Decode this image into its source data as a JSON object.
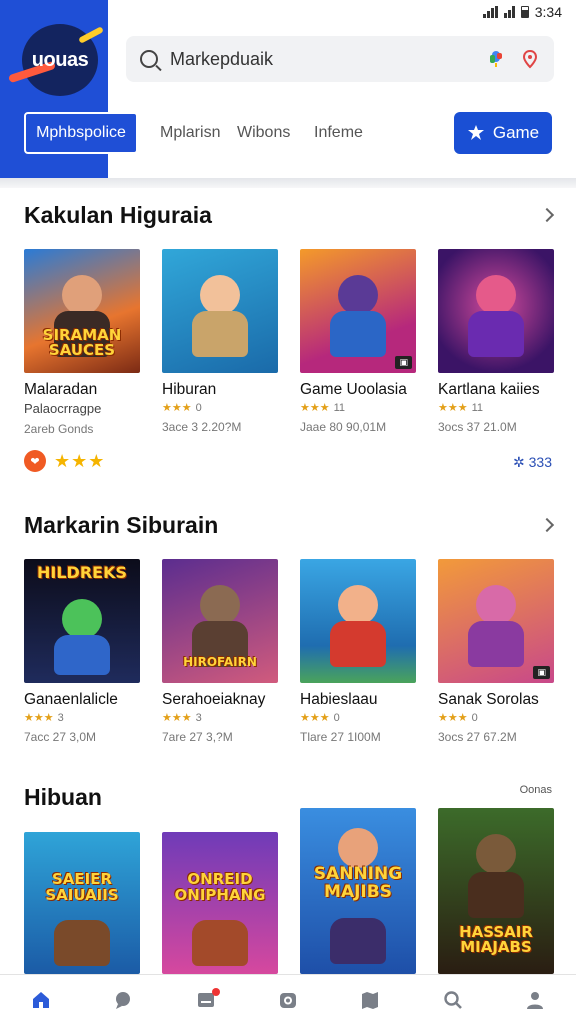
{
  "status_bar": {
    "time": "3:34"
  },
  "brand": {
    "logo_text": "uouas"
  },
  "search": {
    "value": "Markepduaik"
  },
  "tabs": [
    {
      "label": "Mphbspolice"
    },
    {
      "label": "Mplarisn"
    },
    {
      "label": "Wibons"
    },
    {
      "label": "Infeme"
    }
  ],
  "game_button": {
    "label": "Game"
  },
  "sections": [
    {
      "title": "Kakulan Higuraia",
      "cards": [
        {
          "title": "Malaradan",
          "subtitle": "Palaocrragpe",
          "meta": "2areb Gonds",
          "art": "SIRAMAN SAUCES"
        },
        {
          "title": "Hiburan",
          "stars": "★★★",
          "rating": "0",
          "meta": "3ace 3 2.20?M",
          "art": ""
        },
        {
          "title": "Game Uoolasia",
          "stars": "★★★",
          "rating": "11",
          "meta": "Jaae 80 90,01M",
          "art": ""
        },
        {
          "title": "Kartlana kaiies",
          "stars": "★★★",
          "rating": "11",
          "meta": "3ocs 37 21.0M",
          "art": ""
        }
      ],
      "rating_row": {
        "dot": "❤",
        "stars": "★★★"
      },
      "count": "333"
    },
    {
      "title": "Markarin Siburain",
      "cards": [
        {
          "title": "Ganaenlalicle",
          "stars": "★★★",
          "rating": "3",
          "meta": "7acc 27 3,0M",
          "art": "HILDREKS"
        },
        {
          "title": "Serahoeiaknay",
          "stars": "★★★",
          "rating": "3",
          "meta": "7are 27 3,?M",
          "art": "HIROFAIRN"
        },
        {
          "title": "Habieslaau",
          "stars": "★★★",
          "rating": "0",
          "meta": "Tlare 27 1I00M",
          "art": ""
        },
        {
          "title": "Sanak Sorolas",
          "stars": "★★★",
          "rating": "0",
          "meta": "3ocs 27 67.2M",
          "art": ""
        }
      ]
    },
    {
      "title": "Hibuan",
      "more": "Oonas",
      "cards": [
        {
          "art": "SAEIER SAIUAIIS"
        },
        {
          "art": "ONREID ONIPHANG"
        },
        {
          "art": "SANNING MAJIBS"
        },
        {
          "art": "HASSAIR MIAJABS"
        }
      ]
    }
  ],
  "bottom_nav": [
    "home-icon",
    "chat-icon",
    "inbox-icon",
    "camera-icon",
    "map-icon",
    "search-icon",
    "profile-icon"
  ],
  "colors": {
    "brand_blue": "#1f4fd6",
    "accent_orange": "#f05a23",
    "star_yellow": "#f5b400"
  }
}
